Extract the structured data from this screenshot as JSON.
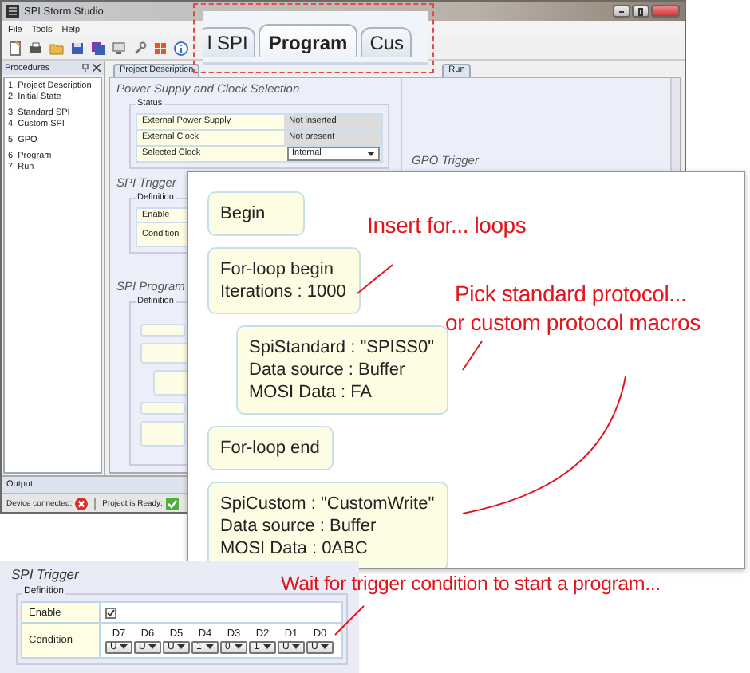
{
  "window": {
    "title": "SPI Storm Studio"
  },
  "menu": [
    "File",
    "Tools",
    "Help"
  ],
  "procedures": {
    "title": "Procedures",
    "groups": [
      {
        "items": [
          "1. Project Description",
          "2. Initial State"
        ]
      },
      {
        "items": [
          "3. Standard SPI",
          "4. Custom SPI"
        ]
      },
      {
        "items": [
          "5. GPO"
        ]
      },
      {
        "items": [
          "6. Program",
          "7. Run"
        ]
      }
    ]
  },
  "tabs": [
    {
      "label": "Project Description",
      "selected": false
    },
    {
      "label": "Run",
      "selected": false
    }
  ],
  "power": {
    "title": "Power Supply and Clock Selection",
    "group": "Status",
    "rows": [
      {
        "label": "External Power Supply",
        "value": "Not inserted",
        "kind": "text"
      },
      {
        "label": "External Clock",
        "value": "Not present",
        "kind": "text"
      },
      {
        "label": "Selected Clock",
        "value": "Internal",
        "kind": "dropdown"
      }
    ]
  },
  "spi_trigger": {
    "title": "SPI Trigger",
    "group": "Definition",
    "rows": [
      "Enable",
      "Condition"
    ]
  },
  "gpo_trigger": {
    "title": "GPO Trigger"
  },
  "spi_program": {
    "title": "SPI Program",
    "group": "Definition"
  },
  "output": {
    "title": "Output"
  },
  "status_bar": [
    {
      "label": "Device connected:",
      "ok": false
    },
    {
      "label": "Project is Ready:",
      "ok": true
    }
  ],
  "zoom_tabs": [
    {
      "label": "l SPI",
      "selected": false
    },
    {
      "label": "Program",
      "selected": true
    },
    {
      "label": "Cus",
      "selected": false
    }
  ],
  "program_steps": [
    {
      "lines": [
        "Begin"
      ]
    },
    {
      "lines": [
        "For-loop begin",
        "Iterations : 1000"
      ],
      "children": [
        {
          "lines": [
            "SpiStandard : \"SPISS0\"",
            "Data source : Buffer",
            "MOSI Data : FA"
          ]
        }
      ]
    },
    {
      "lines": [
        "For-loop end"
      ]
    },
    {
      "lines": [
        "SpiCustom : \"CustomWrite\"",
        "Data source : Buffer",
        "MOSI Data : 0ABC"
      ]
    }
  ],
  "annotations": [
    {
      "lines": [
        "Insert for... loops"
      ]
    },
    {
      "lines": [
        "Pick standard protocol...",
        "or custom protocol macros"
      ]
    },
    {
      "lines": [
        "Wait for trigger condition to start a program..."
      ]
    }
  ],
  "trigger_detail": {
    "title": "SPI Trigger",
    "group": "Definition",
    "enable_label": "Enable",
    "enabled": true,
    "condition_label": "Condition",
    "bits": [
      {
        "label": "D7",
        "value": "U"
      },
      {
        "label": "D6",
        "value": "U"
      },
      {
        "label": "D5",
        "value": "U"
      },
      {
        "label": "D4",
        "value": "1"
      },
      {
        "label": "D3",
        "value": "0"
      },
      {
        "label": "D2",
        "value": "1"
      },
      {
        "label": "D1",
        "value": "U"
      },
      {
        "label": "D0",
        "value": "U"
      }
    ]
  }
}
